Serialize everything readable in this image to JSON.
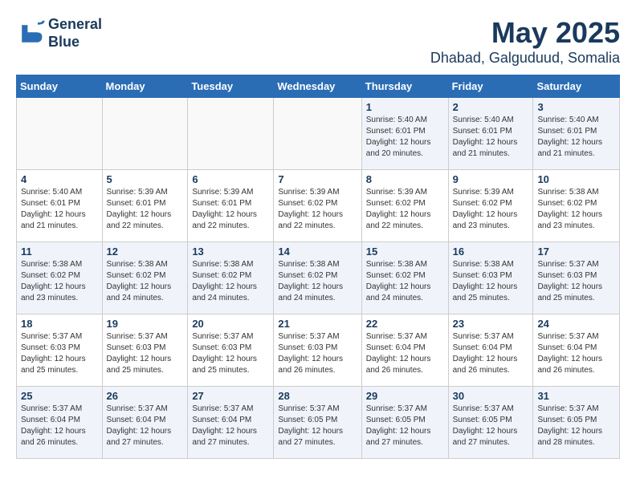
{
  "header": {
    "logo_line1": "General",
    "logo_line2": "Blue",
    "month": "May 2025",
    "location": "Dhabad, Galguduud, Somalia"
  },
  "weekdays": [
    "Sunday",
    "Monday",
    "Tuesday",
    "Wednesday",
    "Thursday",
    "Friday",
    "Saturday"
  ],
  "weeks": [
    [
      {
        "day": "",
        "info": ""
      },
      {
        "day": "",
        "info": ""
      },
      {
        "day": "",
        "info": ""
      },
      {
        "day": "",
        "info": ""
      },
      {
        "day": "1",
        "info": "Sunrise: 5:40 AM\nSunset: 6:01 PM\nDaylight: 12 hours\nand 20 minutes."
      },
      {
        "day": "2",
        "info": "Sunrise: 5:40 AM\nSunset: 6:01 PM\nDaylight: 12 hours\nand 21 minutes."
      },
      {
        "day": "3",
        "info": "Sunrise: 5:40 AM\nSunset: 6:01 PM\nDaylight: 12 hours\nand 21 minutes."
      }
    ],
    [
      {
        "day": "4",
        "info": "Sunrise: 5:40 AM\nSunset: 6:01 PM\nDaylight: 12 hours\nand 21 minutes."
      },
      {
        "day": "5",
        "info": "Sunrise: 5:39 AM\nSunset: 6:01 PM\nDaylight: 12 hours\nand 22 minutes."
      },
      {
        "day": "6",
        "info": "Sunrise: 5:39 AM\nSunset: 6:01 PM\nDaylight: 12 hours\nand 22 minutes."
      },
      {
        "day": "7",
        "info": "Sunrise: 5:39 AM\nSunset: 6:02 PM\nDaylight: 12 hours\nand 22 minutes."
      },
      {
        "day": "8",
        "info": "Sunrise: 5:39 AM\nSunset: 6:02 PM\nDaylight: 12 hours\nand 22 minutes."
      },
      {
        "day": "9",
        "info": "Sunrise: 5:39 AM\nSunset: 6:02 PM\nDaylight: 12 hours\nand 23 minutes."
      },
      {
        "day": "10",
        "info": "Sunrise: 5:38 AM\nSunset: 6:02 PM\nDaylight: 12 hours\nand 23 minutes."
      }
    ],
    [
      {
        "day": "11",
        "info": "Sunrise: 5:38 AM\nSunset: 6:02 PM\nDaylight: 12 hours\nand 23 minutes."
      },
      {
        "day": "12",
        "info": "Sunrise: 5:38 AM\nSunset: 6:02 PM\nDaylight: 12 hours\nand 24 minutes."
      },
      {
        "day": "13",
        "info": "Sunrise: 5:38 AM\nSunset: 6:02 PM\nDaylight: 12 hours\nand 24 minutes."
      },
      {
        "day": "14",
        "info": "Sunrise: 5:38 AM\nSunset: 6:02 PM\nDaylight: 12 hours\nand 24 minutes."
      },
      {
        "day": "15",
        "info": "Sunrise: 5:38 AM\nSunset: 6:02 PM\nDaylight: 12 hours\nand 24 minutes."
      },
      {
        "day": "16",
        "info": "Sunrise: 5:38 AM\nSunset: 6:03 PM\nDaylight: 12 hours\nand 25 minutes."
      },
      {
        "day": "17",
        "info": "Sunrise: 5:37 AM\nSunset: 6:03 PM\nDaylight: 12 hours\nand 25 minutes."
      }
    ],
    [
      {
        "day": "18",
        "info": "Sunrise: 5:37 AM\nSunset: 6:03 PM\nDaylight: 12 hours\nand 25 minutes."
      },
      {
        "day": "19",
        "info": "Sunrise: 5:37 AM\nSunset: 6:03 PM\nDaylight: 12 hours\nand 25 minutes."
      },
      {
        "day": "20",
        "info": "Sunrise: 5:37 AM\nSunset: 6:03 PM\nDaylight: 12 hours\nand 25 minutes."
      },
      {
        "day": "21",
        "info": "Sunrise: 5:37 AM\nSunset: 6:03 PM\nDaylight: 12 hours\nand 26 minutes."
      },
      {
        "day": "22",
        "info": "Sunrise: 5:37 AM\nSunset: 6:04 PM\nDaylight: 12 hours\nand 26 minutes."
      },
      {
        "day": "23",
        "info": "Sunrise: 5:37 AM\nSunset: 6:04 PM\nDaylight: 12 hours\nand 26 minutes."
      },
      {
        "day": "24",
        "info": "Sunrise: 5:37 AM\nSunset: 6:04 PM\nDaylight: 12 hours\nand 26 minutes."
      }
    ],
    [
      {
        "day": "25",
        "info": "Sunrise: 5:37 AM\nSunset: 6:04 PM\nDaylight: 12 hours\nand 26 minutes."
      },
      {
        "day": "26",
        "info": "Sunrise: 5:37 AM\nSunset: 6:04 PM\nDaylight: 12 hours\nand 27 minutes."
      },
      {
        "day": "27",
        "info": "Sunrise: 5:37 AM\nSunset: 6:04 PM\nDaylight: 12 hours\nand 27 minutes."
      },
      {
        "day": "28",
        "info": "Sunrise: 5:37 AM\nSunset: 6:05 PM\nDaylight: 12 hours\nand 27 minutes."
      },
      {
        "day": "29",
        "info": "Sunrise: 5:37 AM\nSunset: 6:05 PM\nDaylight: 12 hours\nand 27 minutes."
      },
      {
        "day": "30",
        "info": "Sunrise: 5:37 AM\nSunset: 6:05 PM\nDaylight: 12 hours\nand 27 minutes."
      },
      {
        "day": "31",
        "info": "Sunrise: 5:37 AM\nSunset: 6:05 PM\nDaylight: 12 hours\nand 28 minutes."
      }
    ]
  ]
}
